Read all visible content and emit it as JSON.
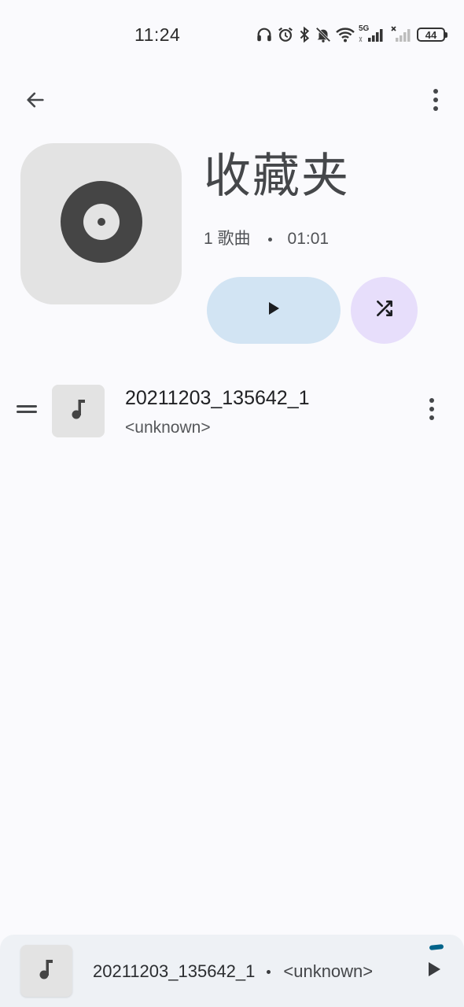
{
  "status_bar": {
    "time": "11:24",
    "battery": "44",
    "icons": [
      "headphones-icon",
      "alarm-icon",
      "bluetooth-icon",
      "do-not-disturb-icon",
      "wifi-icon",
      "signal-5g-icon",
      "signal-no-sim-icon",
      "battery-icon"
    ],
    "network_label": "5G"
  },
  "toolbar": {
    "back_icon": "arrow-left-icon",
    "more_icon": "more-vertical-icon"
  },
  "playlist": {
    "title": "收藏夹",
    "song_count": "1 歌曲",
    "duration": "01:01",
    "cover_icon": "vinyl-disc-icon"
  },
  "actions": {
    "play_icon": "play-icon",
    "shuffle_icon": "shuffle-icon",
    "play_bg": "#D2E4F3",
    "shuffle_bg": "#E7DEFB"
  },
  "tracks": [
    {
      "title": "20211203_135642_1",
      "artist": "<unknown>"
    }
  ],
  "mini_player": {
    "title": "20211203_135642_1",
    "artist": "<unknown>",
    "accent": "#00638A"
  }
}
